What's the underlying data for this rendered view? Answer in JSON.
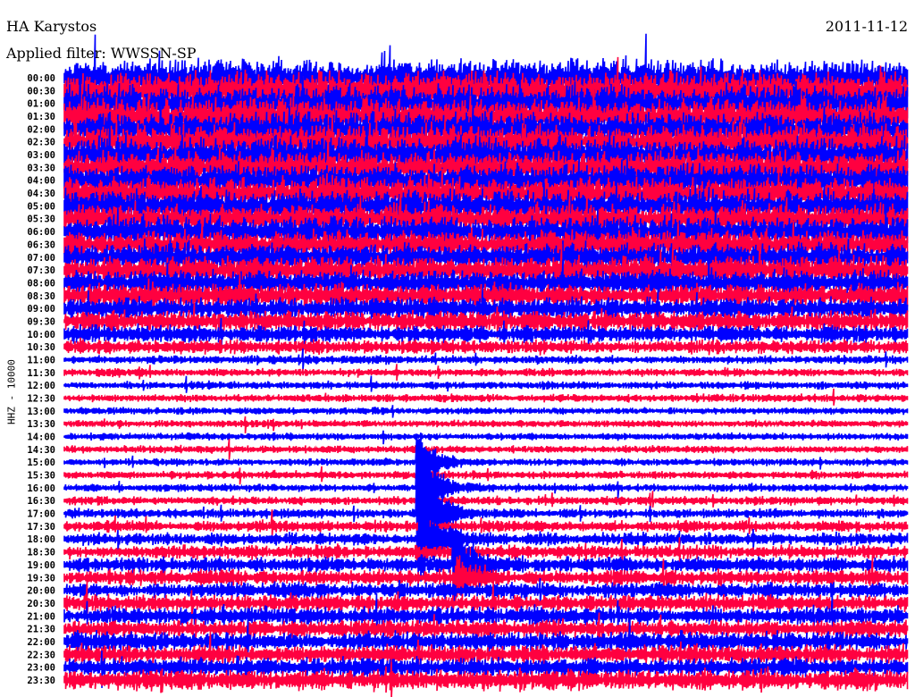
{
  "header": {
    "station": "HA Karystos",
    "date": "2011-11-12",
    "filter": "Applied filter: WWSSN-SP"
  },
  "chart_data": {
    "type": "line",
    "title": "HA Karystos",
    "ylabel": "HHZ - 10000",
    "minutes_per_line": 30,
    "colors": {
      "even": "#0000ff",
      "odd": "#ff0040"
    },
    "row_labels": [
      "00:00",
      "00:30",
      "01:00",
      "01:30",
      "02:00",
      "02:30",
      "03:00",
      "03:30",
      "04:00",
      "04:30",
      "05:00",
      "05:30",
      "06:00",
      "06:30",
      "07:00",
      "07:30",
      "08:00",
      "08:30",
      "09:00",
      "09:30",
      "10:00",
      "10:30",
      "11:00",
      "11:30",
      "12:00",
      "12:30",
      "13:00",
      "13:30",
      "14:00",
      "14:30",
      "15:00",
      "15:30",
      "16:00",
      "16:30",
      "17:00",
      "17:30",
      "18:00",
      "18:30",
      "19:00",
      "19:30",
      "20:00",
      "20:30",
      "21:00",
      "21:30",
      "22:00",
      "22:30",
      "23:00",
      "23:30"
    ],
    "row_amplitude": [
      2.4,
      2.4,
      2.3,
      2.3,
      2.2,
      2.2,
      2.2,
      2.1,
      2.1,
      2.0,
      2.0,
      1.9,
      1.9,
      1.8,
      1.8,
      1.7,
      1.6,
      1.5,
      1.4,
      1.3,
      1.1,
      0.9,
      0.55,
      0.5,
      0.5,
      0.5,
      0.45,
      0.45,
      0.45,
      0.45,
      0.45,
      0.5,
      0.5,
      0.55,
      0.6,
      0.7,
      0.8,
      0.9,
      0.95,
      1.0,
      1.0,
      1.05,
      1.1,
      1.1,
      1.2,
      1.2,
      1.25,
      1.3
    ],
    "events": [
      {
        "row": "15:00",
        "minute": 12.6,
        "amplitude": 5
      },
      {
        "row": "16:00",
        "minute": 12.6,
        "amplitude": 9
      },
      {
        "row": "17:00",
        "minute": 12.6,
        "amplitude": 12
      },
      {
        "row": "18:00",
        "minute": 12.7,
        "amplitude": 8
      },
      {
        "row": "19:00",
        "minute": 13.9,
        "amplitude": 6
      },
      {
        "row": "19:30",
        "minute": 14.0,
        "amplitude": 3
      }
    ]
  }
}
